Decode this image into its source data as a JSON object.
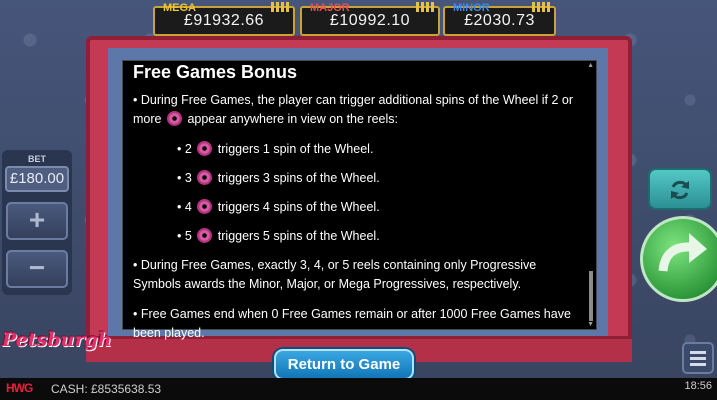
{
  "jackpots": [
    {
      "tag": "MEGA",
      "value": "£91932.66",
      "tag_color": "#f0c42e"
    },
    {
      "tag": "MAJOR",
      "value": "£10992.10",
      "tag_color": "#e84e4e"
    },
    {
      "tag": "MINOR",
      "value": "£2030.73",
      "tag_color": "#3b8be6"
    }
  ],
  "bet": {
    "label": "BET",
    "value": "£180.00",
    "increase_label": "+",
    "decrease_label": "−"
  },
  "logo": {
    "text": "Petsburgh"
  },
  "modal": {
    "title": "Free Games Bonus",
    "intro_before": "• During Free Games, the player can trigger additional spins of the Wheel if 2 or more",
    "intro_after": "appear anywhere in view on the reels:",
    "triggers": [
      {
        "count": "• 2",
        "text": "triggers 1 spin of the Wheel."
      },
      {
        "count": "• 3",
        "text": "triggers 3 spins of the Wheel."
      },
      {
        "count": "• 4",
        "text": "triggers 4 spins of the Wheel."
      },
      {
        "count": "• 5",
        "text": "triggers 5 spins of the Wheel."
      }
    ],
    "progressive_text": "• During Free Games, exactly 3, 4, or 5 reels containing only Progressive Symbols awards the Minor, Major, or Mega Progressives, respectively.",
    "end_text": "• Free Games end when 0 Free Games remain or after 1000 Free Games have been played."
  },
  "return_button": {
    "label": "Return to Game"
  },
  "status_bar": {
    "brand": "HWG",
    "cash": "CASH: £8535638.53",
    "time": "18:56"
  },
  "colors": {
    "frame": "#c43a55",
    "modal_bg": "#000000",
    "return_button": "#1c86c8",
    "spin": "#2f9a3c"
  }
}
